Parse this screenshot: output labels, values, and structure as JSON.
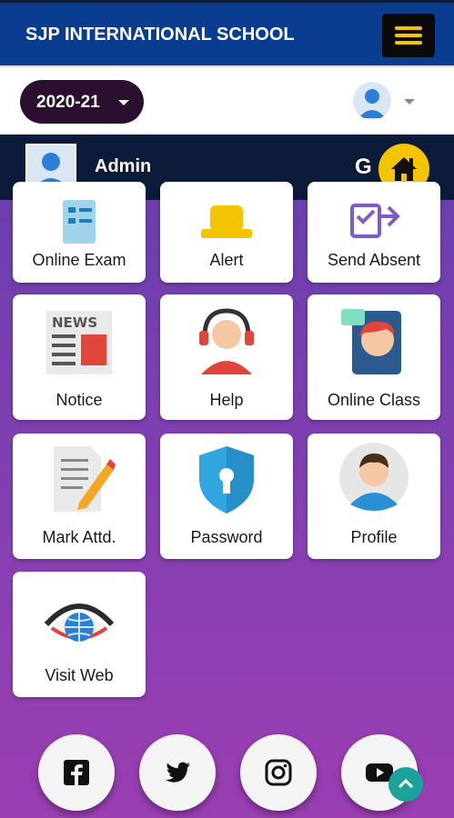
{
  "app": {
    "title": "SJP INTERNATIONAL SCHOOL",
    "accent_color": "#0a3d8f",
    "menu_icon": "hamburger-menu-icon"
  },
  "toolbar": {
    "session_year": "2020-21",
    "user_icon": "user-avatar-icon"
  },
  "admin": {
    "name": "Admin",
    "g_label": "G",
    "home_icon": "home-icon",
    "home_color": "#f5c400"
  },
  "tiles": [
    {
      "label": "Online Exam",
      "icon": "exam-form-icon"
    },
    {
      "label": "Alert",
      "icon": "bell-icon"
    },
    {
      "label": "Send Absent",
      "icon": "send-absent-icon"
    },
    {
      "label": "Notice",
      "icon": "newspaper-icon"
    },
    {
      "label": "Help",
      "icon": "headset-support-icon"
    },
    {
      "label": "Online Class",
      "icon": "video-class-icon"
    },
    {
      "label": "Mark Attd.",
      "icon": "document-pencil-icon"
    },
    {
      "label": "Password",
      "icon": "shield-keyhole-icon"
    },
    {
      "label": "Profile",
      "icon": "profile-person-icon"
    },
    {
      "label": "Visit Web",
      "icon": "eye-globe-icon"
    }
  ],
  "social": [
    {
      "name": "facebook-icon"
    },
    {
      "name": "twitter-icon"
    },
    {
      "name": "instagram-icon"
    },
    {
      "name": "youtube-icon"
    }
  ],
  "scroll_top_icon": "chevron-up-icon"
}
